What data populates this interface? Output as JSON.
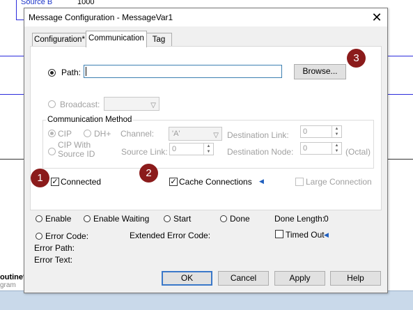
{
  "background": {
    "cells": [
      "Source B",
      "1000"
    ],
    "routine_label": "outine*",
    "routine_sub": "gram"
  },
  "dialog": {
    "title": "Message Configuration - MessageVar1",
    "tabs": [
      {
        "label": "Configuration*",
        "active": false
      },
      {
        "label": "Communication",
        "active": true
      },
      {
        "label": "Tag",
        "active": false
      }
    ],
    "path": {
      "label": "Path:",
      "value": "",
      "selected": true
    },
    "browse_label": "Browse...",
    "broadcast": {
      "label": "Broadcast:",
      "selected": false,
      "value": ""
    },
    "comm_method": {
      "title": "Communication Method",
      "cip": "CIP",
      "dhplus": "DH+",
      "cip_source": "CIP With Source ID",
      "channel_label": "Channel:",
      "channel_value": "'A'",
      "dest_link_label": "Destination Link:",
      "dest_link_value": "0",
      "source_link_label": "Source Link:",
      "source_link_value": "0",
      "dest_node_label": "Destination Node:",
      "dest_node_value": "0",
      "octal_label": "(Octal)"
    },
    "options": {
      "connected": {
        "label": "Connected",
        "checked": true
      },
      "cache_connections": {
        "label": "Cache Connections",
        "checked": true
      },
      "large_connection": {
        "label": "Large Connection",
        "checked": false
      }
    },
    "status": {
      "enable": "Enable",
      "enable_waiting": "Enable Waiting",
      "start": "Start",
      "done": "Done",
      "done_length_label": "Done Length:",
      "done_length_value": "0",
      "error_code": "Error Code:",
      "extended_error_code": "Extended Error Code:",
      "timed_out": "Timed Out",
      "error_path": "Error Path:",
      "error_text": "Error Text:"
    },
    "buttons": {
      "ok": "OK",
      "cancel": "Cancel",
      "apply": "Apply",
      "help": "Help"
    },
    "badges": [
      "1",
      "2",
      "3"
    ]
  },
  "colors": {
    "accent": "#3a78c9",
    "badge": "#8b1b1b",
    "arrow": "#1f5fbf"
  }
}
